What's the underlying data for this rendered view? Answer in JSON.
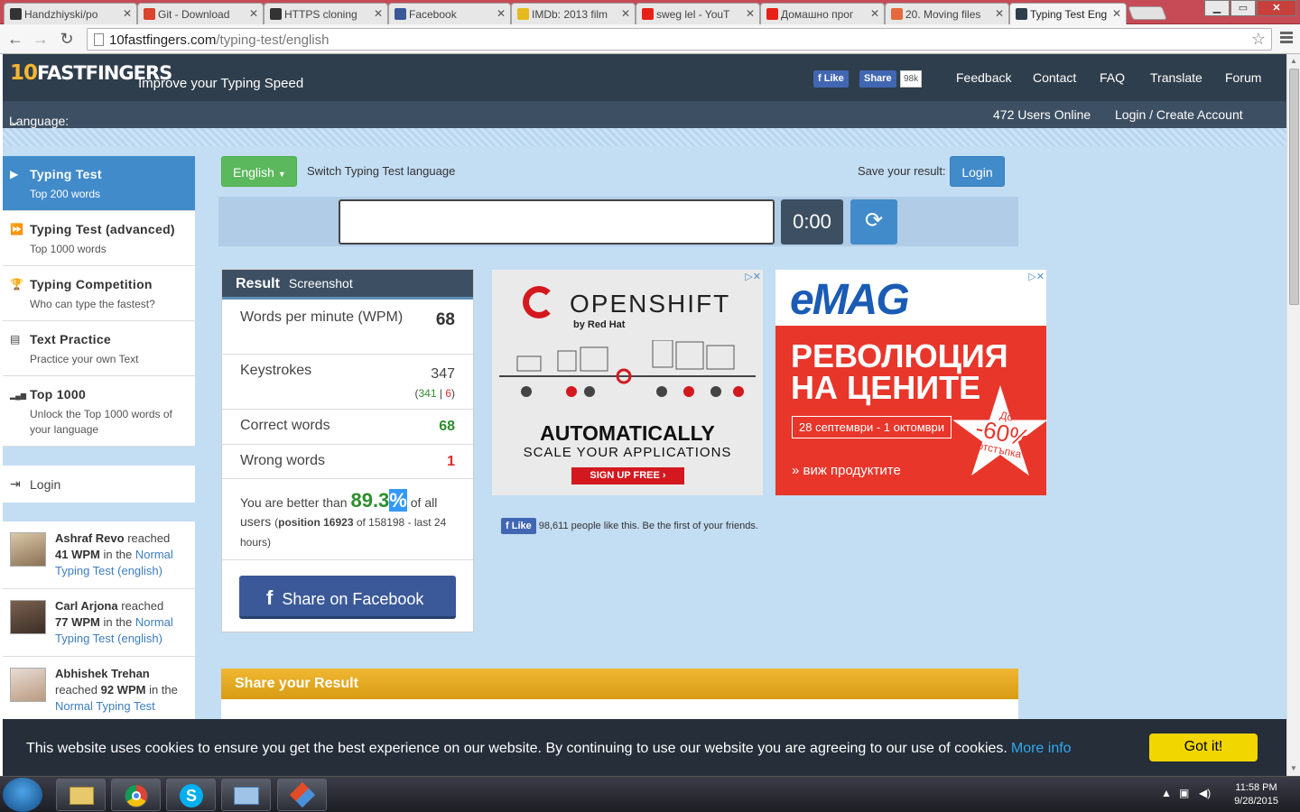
{
  "browser": {
    "tabs": [
      {
        "title": "Handzhiyski/po",
        "favicon_color": "#333333"
      },
      {
        "title": "Git - Download",
        "favicon_color": "#d9442b"
      },
      {
        "title": "HTTPS cloning",
        "favicon_color": "#333333"
      },
      {
        "title": "Facebook",
        "favicon_color": "#3b5998"
      },
      {
        "title": "IMDb: 2013 film",
        "favicon_color": "#e6b91e"
      },
      {
        "title": "sweg lel - YouT",
        "favicon_color": "#e62117"
      },
      {
        "title": "Домашно прог",
        "favicon_color": "#e62117"
      },
      {
        "title": "20. Moving files",
        "favicon_color": "#e46a3d"
      },
      {
        "title": "Typing Test Eng",
        "favicon_color": "#2f3e4c"
      }
    ],
    "url_domain": "10fastfingers.com",
    "url_path": "/typing-test/english"
  },
  "site": {
    "logo_num": "10",
    "logo_text": "FASTFINGERS",
    "tagline": "Improve your Typing Speed",
    "fb_like": "Like",
    "fb_share": "Share",
    "fb_count": "98k",
    "nav": [
      "Feedback",
      "Contact",
      "FAQ",
      "Translate",
      "Forum"
    ],
    "language_label": "Language: English",
    "users_online": "472 Users Online",
    "login_link": "Login / Create Account"
  },
  "sidebar": {
    "items": [
      {
        "title": "Typing Test",
        "subtitle": "Top 200 words",
        "icon": "▶"
      },
      {
        "title": "Typing Test (advanced)",
        "subtitle": "Top 1000 words",
        "icon": "⏩"
      },
      {
        "title": "Typing Competition",
        "subtitle": "Who can type the fastest?",
        "icon": "🏆"
      },
      {
        "title": "Text Practice",
        "subtitle": "Practice your own Text",
        "icon": "▤"
      },
      {
        "title": "Top 1000",
        "subtitle": "Unlock the Top 1000 words of your language",
        "icon": "▂▄▆"
      }
    ],
    "login": "Login",
    "feed": [
      {
        "name": "Ashraf Revo",
        "mid": "reached",
        "wpm": "41 WPM",
        "mid2": "in the",
        "link": "Normal Typing Test (english)"
      },
      {
        "name": "Carl Arjona",
        "mid": "reached",
        "wpm": "77 WPM",
        "mid2": "in the",
        "link": "Normal Typing Test (english)"
      },
      {
        "name": "Abhishek Trehan",
        "mid": "reached",
        "wpm": "92 WPM",
        "mid2": "in the",
        "link": "Normal Typing Test"
      }
    ]
  },
  "controls": {
    "language_btn": "English",
    "switch_text": "Switch Typing Test language",
    "save_text": "Save your result:",
    "login_btn": "Login",
    "timer": "0:00"
  },
  "result": {
    "title": "Result",
    "screenshot": "Screenshot",
    "wpm_label": "Words per minute (WPM)",
    "wpm": "68",
    "keystrokes_label": "Keystrokes",
    "keystrokes": "347",
    "keys_correct": "341",
    "keys_wrong": "6",
    "correct_label": "Correct words",
    "correct": "68",
    "wrong_label": "Wrong words",
    "wrong": "1",
    "better_pre": "You are better than",
    "percent": "89.3",
    "percent_sign": "%",
    "better_post": "of all users",
    "position_label": "position 16923",
    "position_rest": "of 158198 - last 24 hours",
    "share_fb": "Share on Facebook"
  },
  "ads": {
    "openshift_brand": "OPENSHIFT",
    "openshift_by": "by Red Hat",
    "openshift_h1": "AUTOMATICALLY",
    "openshift_h2": "SCALE YOUR APPLICATIONS",
    "openshift_cta": "SIGN UP FREE",
    "emag_brand": "eMAG",
    "emag_h1": "РЕВОЛЮЦИЯ",
    "emag_h2": "НА ЦЕНИТЕ",
    "emag_dates": "28 септември - 1 октомври",
    "emag_upto": "До",
    "emag_pct": "-60%",
    "emag_off": "отстъпка",
    "emag_cta": "» виж продуктите"
  },
  "fb_page_like": {
    "btn": "Like",
    "text": "98,611 people like this. Be the first of your friends."
  },
  "share_result": {
    "title": "Share your Result"
  },
  "cookie": {
    "message": "This website uses cookies to ensure you get the best experience on our website. By continuing to use our website you are agreeing to our use of cookies.",
    "more": "More info",
    "button": "Got it!"
  },
  "taskbar": {
    "time": "11:58 PM",
    "date": "9/28/2015"
  }
}
